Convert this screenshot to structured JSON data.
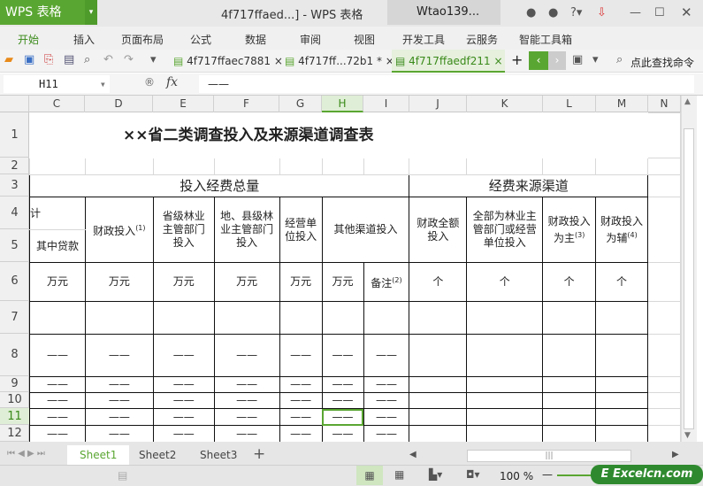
{
  "app": {
    "logo": "WPS 表格",
    "title": "4f717ffaed...] - WPS 表格",
    "user": "Wtao139..."
  },
  "menu": [
    "开始",
    "插入",
    "页面布局",
    "公式",
    "数据",
    "审阅",
    "视图",
    "开发工具",
    "云服务",
    "智能工具箱"
  ],
  "doc_tabs": [
    "4f717ffaec7881",
    "4f717ff...72b1 *",
    "4f717ffaedf211"
  ],
  "search_cmd": "点此查找命令",
  "formula": {
    "cell": "H11",
    "fx": "fx",
    "value": "——"
  },
  "columns": [
    "C",
    "D",
    "E",
    "F",
    "G",
    "H",
    "I",
    "J",
    "K",
    "L",
    "M",
    "N"
  ],
  "rows": [
    "1",
    "2",
    "3",
    "4",
    "5",
    "6",
    "7",
    "8",
    "9",
    "10",
    "11",
    "12"
  ],
  "sheet": {
    "title": "××省二类调查投入及来源渠道调查表",
    "group1": "投入经费总量",
    "group2": "经费来源渠道",
    "c4": "计",
    "c5": "其中贷款",
    "d": "财政投入",
    "d_sup": "(1)",
    "e": "省级林业主管部门投入",
    "f": "地、县级林业主管部门投入",
    "g": "经营单位投入",
    "hi": "其他渠道投入",
    "j": "财政全额投入",
    "k": "全部为林业主管部门或经营单位投入",
    "l": "财政投入为主",
    "l_sup": "(3)",
    "m": "财政投入为辅",
    "m_sup": "(4)",
    "unit": "万元",
    "note": "备注",
    "note_sup": "(2)",
    "count": "个",
    "dash": "——"
  },
  "sheets": [
    "Sheet1",
    "Sheet2",
    "Sheet3"
  ],
  "zoom": "100 %",
  "watermark": "Excelcn.com",
  "accent": "#5aa632"
}
